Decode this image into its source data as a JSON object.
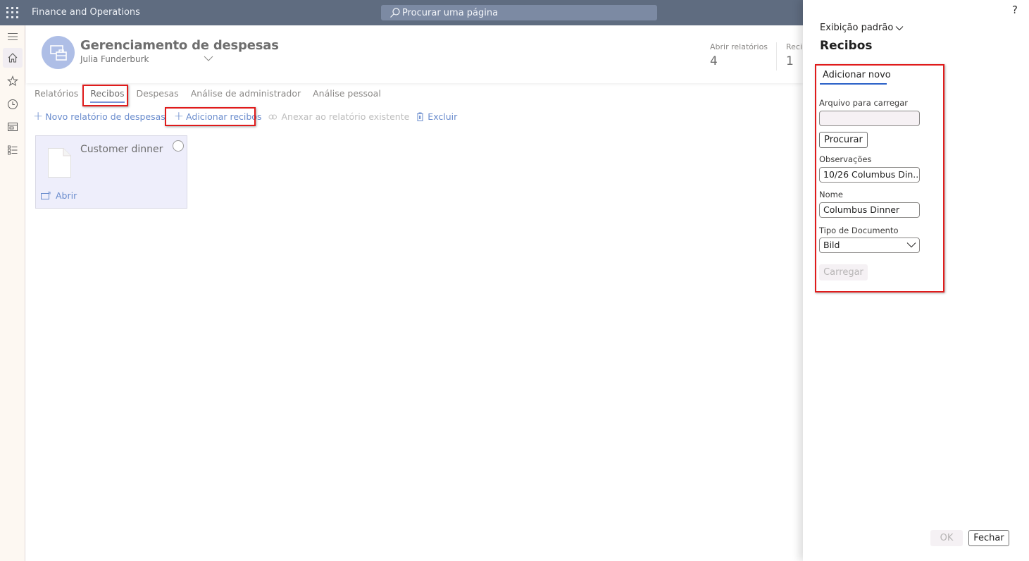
{
  "topbar": {
    "app_title": "Finance and Operations",
    "search_placeholder": "Procurar uma página",
    "icons": [
      "waffle-icon",
      "search-icon"
    ]
  },
  "leftnav": {
    "items": [
      {
        "name": "menu",
        "icon": "hamburger-icon"
      },
      {
        "name": "home",
        "icon": "home-icon",
        "active": true
      },
      {
        "name": "favorites",
        "icon": "star-icon"
      },
      {
        "name": "recent",
        "icon": "clock-icon"
      },
      {
        "name": "workspaces",
        "icon": "workspace-icon"
      },
      {
        "name": "modules",
        "icon": "list-icon"
      }
    ]
  },
  "header": {
    "title": "Gerenciamento de despesas",
    "subtitle": "Julia Funderburk",
    "kpis": [
      {
        "label": "Abrir relatórios",
        "value": "4"
      },
      {
        "label": "Recibos",
        "value": "1"
      }
    ]
  },
  "tabs": [
    {
      "label": "Relatórios",
      "active": false
    },
    {
      "label": "Recibos",
      "active": true
    },
    {
      "label": "Despesas",
      "active": false
    },
    {
      "label": "Análise de administrador",
      "active": false
    },
    {
      "label": "Análise pessoal",
      "active": false
    }
  ],
  "actions": {
    "new_report": "Novo relatório de despesas",
    "add_receipts": "Adicionar recibos",
    "attach_existing": "Anexar ao relatório existente",
    "delete": "Excluir"
  },
  "receipt_card": {
    "title": "Customer dinner",
    "open_label": "Abrir"
  },
  "panel": {
    "help": "?",
    "view_selector": "Exibição padrão",
    "title": "Recibos",
    "tab": "Adicionar novo",
    "file_label": "Arquivo para carregar",
    "file_value": "",
    "browse_button": "Procurar",
    "notes_label": "Observações",
    "notes_value": "10/26 Columbus Din...",
    "name_label": "Nome",
    "name_value": "Columbus Dinner",
    "doctype_label": "Tipo de Documento",
    "doctype_value": "Bild",
    "upload_button": "Carregar",
    "ok_button": "OK",
    "close_button": "Fechar"
  },
  "colors": {
    "topbar": "#5f6c80",
    "accent_link": "#6a8ccd",
    "highlight_box": "#e01b1b",
    "panel_tab_underline": "#2b62c8",
    "card_bg": "#eeeefb",
    "avatar_bg": "#aebee6"
  }
}
